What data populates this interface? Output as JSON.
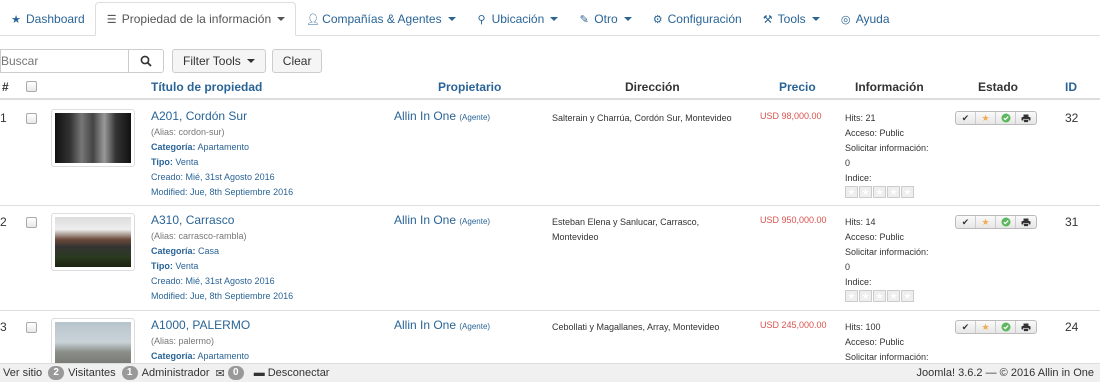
{
  "nav": {
    "tabs": [
      {
        "label": "Dashboard",
        "icon": "star-icon"
      },
      {
        "label": "Propiedad de la información",
        "icon": "list-icon"
      },
      {
        "label": "Compañías & Agentes",
        "icon": "user-icon"
      },
      {
        "label": "Ubicación",
        "icon": "map-marker-icon"
      },
      {
        "label": "Otro",
        "icon": "wrench-icon"
      },
      {
        "label": "Configuración",
        "icon": "gear-icon"
      },
      {
        "label": "Tools",
        "icon": "tools-icon"
      },
      {
        "label": "Ayuda",
        "icon": "life-ring-icon"
      }
    ]
  },
  "toolbar": {
    "search_placeholder": "Buscar",
    "filter_label": "Filter Tools",
    "clear_label": "Clear"
  },
  "table": {
    "headers": {
      "num": "#",
      "title": "Título de propiedad",
      "owner": "Propietario",
      "address": "Dirección",
      "price": "Precio",
      "info": "Información",
      "status": "Estado",
      "id": "ID"
    },
    "rows": [
      {
        "num": "1",
        "title": "A201, Cordón Sur",
        "alias": "(Alias: cordon-sur)",
        "category_label": "Categoría:",
        "category": "Apartamento",
        "type_label": "Tipo:",
        "type": "Venta",
        "created": "Creado: Mié, 31st Agosto 2016",
        "modified": "Modified: Jue, 8th Septiembre 2016",
        "owner": "Allin In One",
        "owner_role": "(Agente)",
        "address": "Salterain y Charrúa, Cordón Sur, Montevideo",
        "price": "USD 98,000.00",
        "hits": "Hits: 21",
        "access": "Acceso: Public",
        "request_label": "Solicitar información:",
        "request_count": "0",
        "index_label": "Indice:",
        "id": "32"
      },
      {
        "num": "2",
        "title": "A310, Carrasco",
        "alias": "(Alias: carrasco-rambla)",
        "category_label": "Categoría:",
        "category": "Casa",
        "type_label": "Tipo:",
        "type": "Venta",
        "created": "Creado: Mié, 31st Agosto 2016",
        "modified": "Modified: Jue, 8th Septiembre 2016",
        "owner": "Allin In One",
        "owner_role": "(Agente)",
        "address": "Esteban Elena y Sanlucar, Carrasco, Montevideo",
        "price": "USD 950,000.00",
        "hits": "Hits: 14",
        "access": "Acceso: Public",
        "request_label": "Solicitar información:",
        "request_count": "0",
        "index_label": "Indice:",
        "id": "31"
      },
      {
        "num": "3",
        "title": "A1000, PALERMO",
        "alias": "(Alias: palermo)",
        "category_label": "Categoría:",
        "category": "Apartamento",
        "owner": "Allin In One",
        "owner_role": "(Agente)",
        "address": "Cebollati y Magallanes, Array, Montevideo",
        "price": "USD 245,000.00",
        "hits": "Hits: 100",
        "access": "Acceso: Public",
        "request_label": "Solicitar información:",
        "id": "24"
      }
    ]
  },
  "status_bar": {
    "view_site": "Ver sitio",
    "visitors_count": "2",
    "visitors_label": "Visitantes",
    "admin_count": "1",
    "admin_label": "Administrador",
    "messages_count": "0",
    "logout_label": "Desconectar",
    "version_info": "Joomla! 3.6.2 — © 2016 Allin in One"
  },
  "colors": {
    "link": "#2a6496",
    "price": "#d9534f",
    "featured_star": "#f0ad4e",
    "published_check": "#5cb85c"
  }
}
